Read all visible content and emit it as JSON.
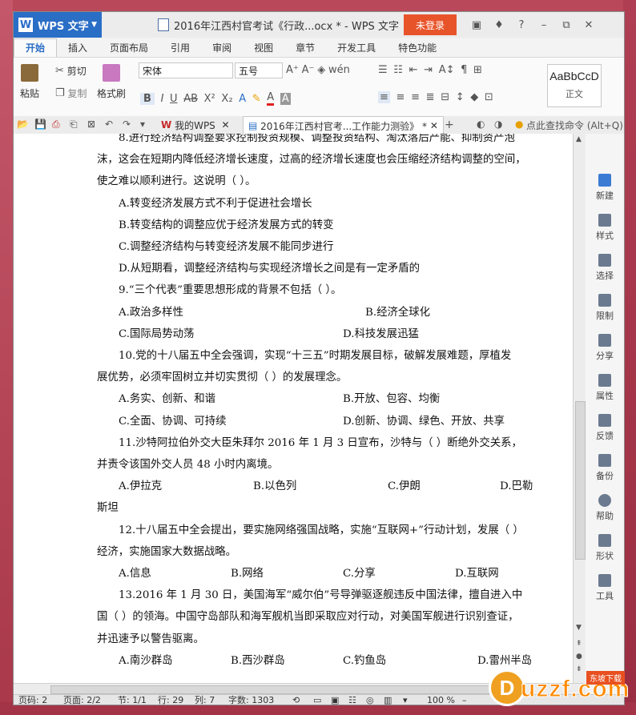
{
  "app": {
    "name": "WPS 文字",
    "logo": "W"
  },
  "title": "2016年江西村官考试《行政...ocx * - WPS 文字",
  "login_label": "未登录",
  "tabs": [
    "开始",
    "插入",
    "页面布局",
    "引用",
    "审阅",
    "视图",
    "章节",
    "开发工具",
    "特色功能"
  ],
  "ribbon": {
    "paste": "粘贴",
    "cut": "剪切",
    "copy": "复制",
    "format_painter": "格式刷",
    "font_name": "宋体",
    "font_size": "五号",
    "style_preview": "AaBbCcD",
    "style_name": "正文"
  },
  "doctabs": {
    "my_wps": "我的WPS",
    "doc": "2016年江西村官考...工作能力测验》 *"
  },
  "search": "点此查找命令 (Alt+Q)",
  "document": {
    "lines": [
      "8.进行经济结构调整要求控制投资规模、调整投资结构、淘汰落后产能、抑制资产泡",
      "沫，这会在短期内降低经济增长速度，过高的经济增长速度也会压缩经济结构调整的空间，",
      "使之难以顺利进行。这说明（   ）。"
    ],
    "q8_options": [
      "A.转变经济发展方式不利于促进社会增长",
      "B.转变结构的调整应优于经济发展方式的转变",
      "C.调整经济结构与转变经济发展不能同步进行",
      "D.从短期看，调整经济结构与实现经济增长之间是有一定矛盾的"
    ],
    "q9": "9.“三个代表”重要思想形成的背景不包括（   ）。",
    "q9_options": [
      "A.政治多样性",
      "B.经济全球化",
      "C.国际局势动荡",
      "D.科技发展迅猛"
    ],
    "q10_lines": [
      "10.党的十八届五中全会强调，实现“十三五”时期发展目标，破解发展难题，厚植发",
      "展优势，必须牢固树立并切实贯彻（   ）的发展理念。"
    ],
    "q10_options": [
      "A.务实、创新、和谐",
      "B.开放、包容、均衡",
      "C.全面、协调、可持续",
      "D.创新、协调、绿色、开放、共享"
    ],
    "q11_lines": [
      "11.沙特阿拉伯外交大臣朱拜尔 2016 年 1 月 3 日宣布，沙特与（   ）断绝外交关系，",
      "并责令该国外交人员 48 小时内离境。"
    ],
    "q11_options": [
      "A.伊拉克",
      "B.以色列",
      "C.伊朗",
      "D.巴勒"
    ],
    "q11_wrap": "斯坦",
    "q12_lines": [
      "12.十八届五中全会提出，要实施网络强国战略，实施“互联网+”行动计划，发展（   ）",
      "经济，实施国家大数据战略。"
    ],
    "q12_options": [
      "A.信息",
      "B.网络",
      "C.分享",
      "D.互联网"
    ],
    "q13_lines": [
      "13.2016 年 1 月 30 日，美国海军“威尔伯”号导弹驱逐舰违反中国法律，擅自进入中",
      "国（   ）的领海。中国守岛部队和海军舰机当即采取应对行动，对美国军舰进行识别查证，",
      "并迅速予以警告驱离。"
    ],
    "q13_options": [
      "A.南沙群岛",
      "B.西沙群岛",
      "C.钓鱼岛",
      "D.雷州半岛"
    ]
  },
  "side_panel": [
    "新建",
    "样式",
    "选择",
    "限制",
    "分享",
    "属性",
    "反馈",
    "备份",
    "帮助",
    "形状",
    "工具"
  ],
  "status": {
    "page": "页码: 2",
    "pages": "页面: 2/2",
    "section": "节: 1/1",
    "row": "行: 29",
    "col": "列: 7",
    "words": "字数: 1303",
    "zoom": "100 %"
  },
  "watermark": {
    "text": "uzzf.com",
    "tag": "东坡下载"
  }
}
